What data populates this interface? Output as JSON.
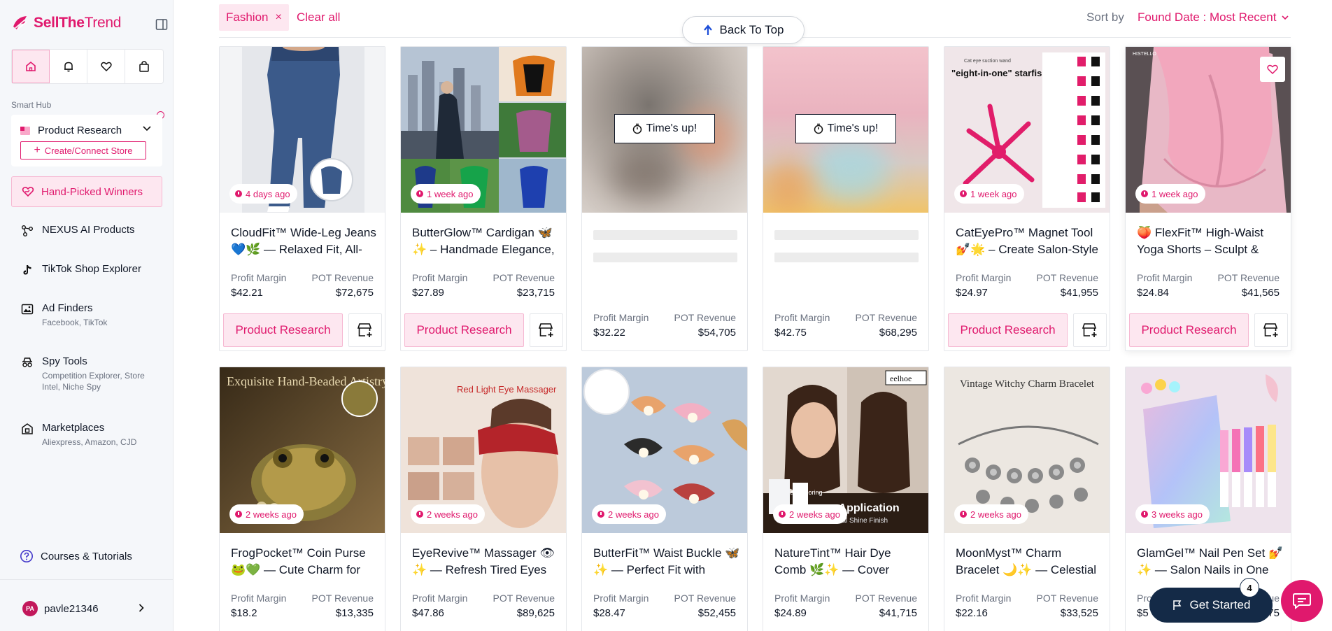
{
  "brand": {
    "name_bold": "SellThe",
    "name_light": "Trend"
  },
  "sidebar": {
    "section_label": "Smart Hub",
    "hub_selected": "Product Research",
    "create_store": "Create/Connect Store",
    "hand_picked": "Hand-Picked Winners",
    "nav": [
      {
        "title": "NEXUS AI Products",
        "sub": ""
      },
      {
        "title": "TikTok Shop Explorer",
        "sub": ""
      },
      {
        "title": "Ad Finders",
        "sub": "Facebook, TikTok"
      },
      {
        "title": "Spy Tools",
        "sub": "Competition Explorer, Store Intel, Niche Spy"
      },
      {
        "title": "Marketplaces",
        "sub": "Aliexpress, Amazon, CJD"
      }
    ],
    "courses": "Courses & Tutorials",
    "user": {
      "initials": "PA",
      "name": "pavle21346"
    }
  },
  "toolbar": {
    "filter_chip": "Fashion",
    "clear_all": "Clear all",
    "back_to_top": "Back To Top",
    "sort_label": "Sort by",
    "sort_value": "Found Date : Most Recent"
  },
  "labels": {
    "profit_margin": "Profit Margin",
    "pot_revenue": "POT Revenue",
    "product_research": "Product Research",
    "times_up": "Time's up!"
  },
  "products_row1": [
    {
      "title": "CloudFit™ Wide-Leg Jeans 💙🌿 — Relaxed Fit, All-",
      "badge": "4 days ago",
      "profit": "$42.21",
      "revenue": "$72,675",
      "locked": false
    },
    {
      "title": "ButterGlow™ Cardigan 🦋✨ – Handmade Elegance,",
      "badge": "1 week ago",
      "profit": "$27.89",
      "revenue": "$23,715",
      "locked": false
    },
    {
      "title": "",
      "badge": "",
      "profit": "$32.22",
      "revenue": "$54,705",
      "locked": true
    },
    {
      "title": "",
      "badge": "",
      "profit": "$42.75",
      "revenue": "$68,295",
      "locked": true
    },
    {
      "title": "CatEyePro™ Magnet Tool 💅🌟 – Create Salon-Style",
      "badge": "1 week ago",
      "profit": "$24.97",
      "revenue": "$41,955",
      "locked": false
    },
    {
      "title": "🍑 FlexFit™ High-Waist Yoga Shorts – Sculpt &",
      "badge": "1 week ago",
      "profit": "$24.84",
      "revenue": "$41,565",
      "locked": false
    }
  ],
  "products_row2": [
    {
      "title": "FrogPocket™ Coin Purse 🐸💚 — Cute Charm for",
      "badge": "2 weeks ago",
      "profit": "$18.2",
      "revenue": "$13,335"
    },
    {
      "title": "EyeRevive™ Massager 👁✨ — Refresh Tired Eyes",
      "badge": "2 weeks ago",
      "profit": "$47.86",
      "revenue": "$89,625"
    },
    {
      "title": "ButterFit™ Waist Buckle 🦋✨ — Perfect Fit with",
      "badge": "2 weeks ago",
      "profit": "$28.47",
      "revenue": "$52,455"
    },
    {
      "title": "NatureTint™ Hair Dye Comb 🌿✨ — Cover",
      "badge": "2 weeks ago",
      "profit": "$24.89",
      "revenue": "$41,715"
    },
    {
      "title": "MoonMyst™ Charm Bracelet 🌙✨ — Celestial",
      "badge": "2 weeks ago",
      "profit": "$22.16",
      "revenue": "$33,525"
    },
    {
      "title": "GlamGel™ Nail Pen Set 💅✨ — Salon Nails in One",
      "badge": "3 weeks ago",
      "profit": "$5",
      "revenue": "75"
    }
  ],
  "image_text": {
    "frog": "Exquisite Hand-Beaded Artistry",
    "eye": "Red Light Eye Massager",
    "hair_brand": "eelhoe",
    "hair": "en Application",
    "hair_sub": "Natural Shine Finish",
    "hair_tag": "Full Head Coloring",
    "bracelet": "Vintage Witchy Charm Bracelet",
    "starfish": "\"eight-in-one\" starfish magnet",
    "shorts_brand": "HISTELLO"
  },
  "floating": {
    "get_started": "Get Started",
    "count": "4"
  },
  "colors": {
    "accent": "#e0196d",
    "navy": "#142a47"
  }
}
